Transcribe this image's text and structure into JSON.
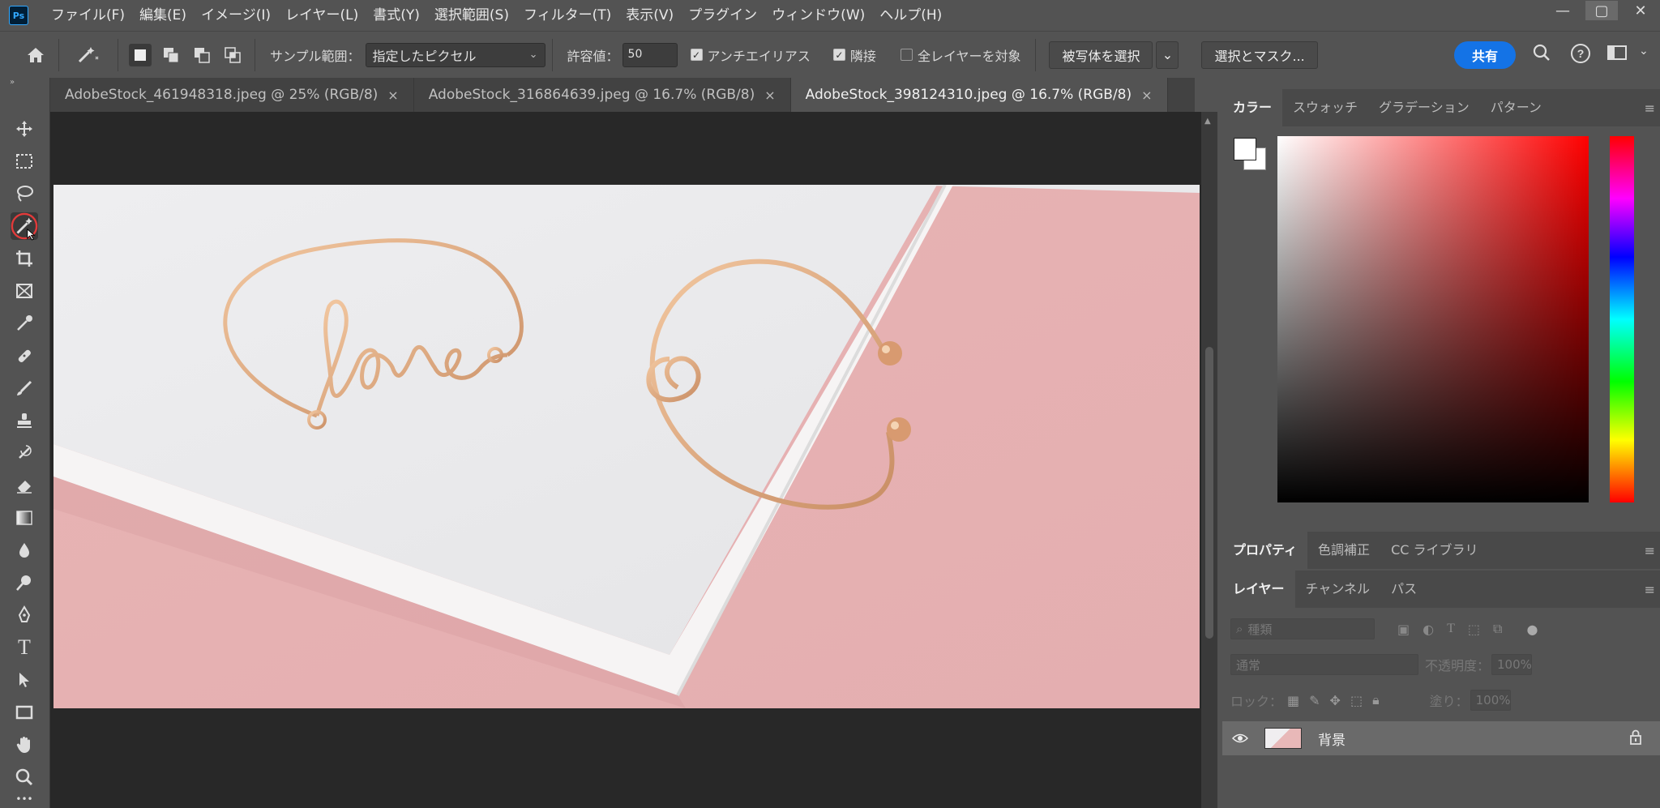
{
  "app": {
    "logo": "Ps",
    "menu": [
      "ファイル(F)",
      "編集(E)",
      "イメージ(I)",
      "レイヤー(L)",
      "書式(Y)",
      "選択範囲(S)",
      "フィルター(T)",
      "表示(V)",
      "プラグイン",
      "ウィンドウ(W)",
      "ヘルプ(H)"
    ],
    "window_controls": [
      "—",
      "▢",
      "✕"
    ]
  },
  "options": {
    "sample_label": "サンプル範囲：",
    "sample_value": "指定したピクセル",
    "tolerance_label": "許容値：",
    "tolerance_value": "50",
    "antialias_label": "アンチエイリアス",
    "contiguous_label": "隣接",
    "all_layers_label": "全レイヤーを対象",
    "select_subject": "被写体を選択",
    "select_mask": "選択とマスク...",
    "share": "共有"
  },
  "tabs": [
    {
      "label": "AdobeStock_461948318.jpeg @ 25% (RGB/8)",
      "close": "×",
      "active": false
    },
    {
      "label": "AdobeStock_316864639.jpeg @ 16.7% (RGB/8)",
      "close": "×",
      "active": false
    },
    {
      "label": "AdobeStock_398124310.jpeg @ 16.7% (RGB/8)",
      "close": "×",
      "active": true
    }
  ],
  "tools": [
    "move-tool",
    "marquee-tool",
    "lasso-tool",
    "magic-wand-tool",
    "crop-tool",
    "frame-tool",
    "eyedropper-tool",
    "healing-brush-tool",
    "brush-tool",
    "clone-stamp-tool",
    "history-brush-tool",
    "eraser-tool",
    "gradient-tool",
    "blur-tool",
    "dodge-tool",
    "pen-tool",
    "type-tool",
    "path-selection-tool",
    "rectangle-tool",
    "hand-tool",
    "zoom-tool",
    "more-tools"
  ],
  "type_tool_glyph": "T",
  "more_glyph": "•••",
  "panels": {
    "color_tabs": [
      "カラー",
      "スウォッチ",
      "グラデーション",
      "パターン"
    ],
    "props_tabs": [
      "プロパティ",
      "色調補正",
      "CC ライブラリ"
    ],
    "layer_tabs": [
      "レイヤー",
      "チャンネル",
      "パス"
    ],
    "filter_placeholder": "種類",
    "blend_mode": "通常",
    "opacity_label": "不透明度：",
    "opacity_value": "100%",
    "lock_label": "ロック：",
    "fill_label": "塗り：",
    "fill_value": "100%",
    "layer_name": "背景"
  },
  "colors": {
    "accent": "#1473e6",
    "workspace": "#535353",
    "canvas_bg": "#282828"
  }
}
